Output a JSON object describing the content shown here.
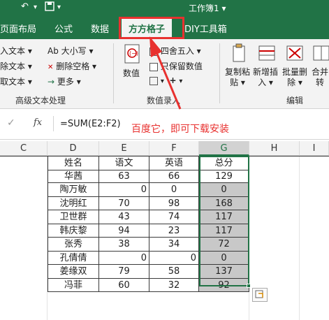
{
  "title_bar": {
    "doc_title": "工作簿1 ▾",
    "undo_glyph": "↶",
    "redo_glyph": "↷"
  },
  "tabs": [
    {
      "label": "页面布局"
    },
    {
      "label": "公式"
    },
    {
      "label": "数据"
    },
    {
      "label": "方方格子",
      "active": true
    },
    {
      "label": "DIY工具箱"
    }
  ],
  "ribbon": {
    "left_items": [
      "入文本 ▾",
      "除文本 ▾",
      "取文本 ▾"
    ],
    "text_items": [
      "Ab 大小写 ▾",
      "删除空格 ▾",
      "更多 ▾"
    ],
    "group_text": "高级文本处理",
    "numeric": {
      "value_label": "数值",
      "round_label": "四舍五入 ▾",
      "keep_value_label": "只保留数值",
      "group_label": "数值录入"
    },
    "edit_buttons": [
      {
        "label": "复制粘\n贴 ▾"
      },
      {
        "label": "新增插\n入 ▾"
      },
      {
        "label": "批量删\n除 ▾"
      },
      {
        "label": "合并\n转"
      }
    ],
    "group_edit": "编辑"
  },
  "formula_bar": {
    "check_glyph": "✓",
    "fx_label": "fx",
    "formula": "=SUM(E2:F2)"
  },
  "annotation": "百度它，即可下载安装",
  "columns": [
    "C",
    "D",
    "E",
    "F",
    "G",
    "H",
    "I"
  ],
  "table": {
    "headers": [
      "姓名",
      "语文",
      "英语",
      "总分"
    ],
    "rows": [
      [
        "华茜",
        "63",
        "66",
        "129"
      ],
      [
        "陶万敏",
        "0",
        "0",
        "0"
      ],
      [
        "沈明红",
        "70",
        "98",
        "168"
      ],
      [
        "卫世群",
        "43",
        "74",
        "117"
      ],
      [
        "韩庆黎",
        "94",
        "23",
        "117"
      ],
      [
        "张秀",
        "38",
        "34",
        "72"
      ],
      [
        "孔倩倩",
        "0",
        "0",
        "0"
      ],
      [
        "姜缘双",
        "79",
        "58",
        "137"
      ],
      [
        "冯菲",
        "60",
        "32",
        "92"
      ]
    ]
  },
  "colors": {
    "excel_green": "#217346",
    "annotation_red": "#e8312f"
  }
}
